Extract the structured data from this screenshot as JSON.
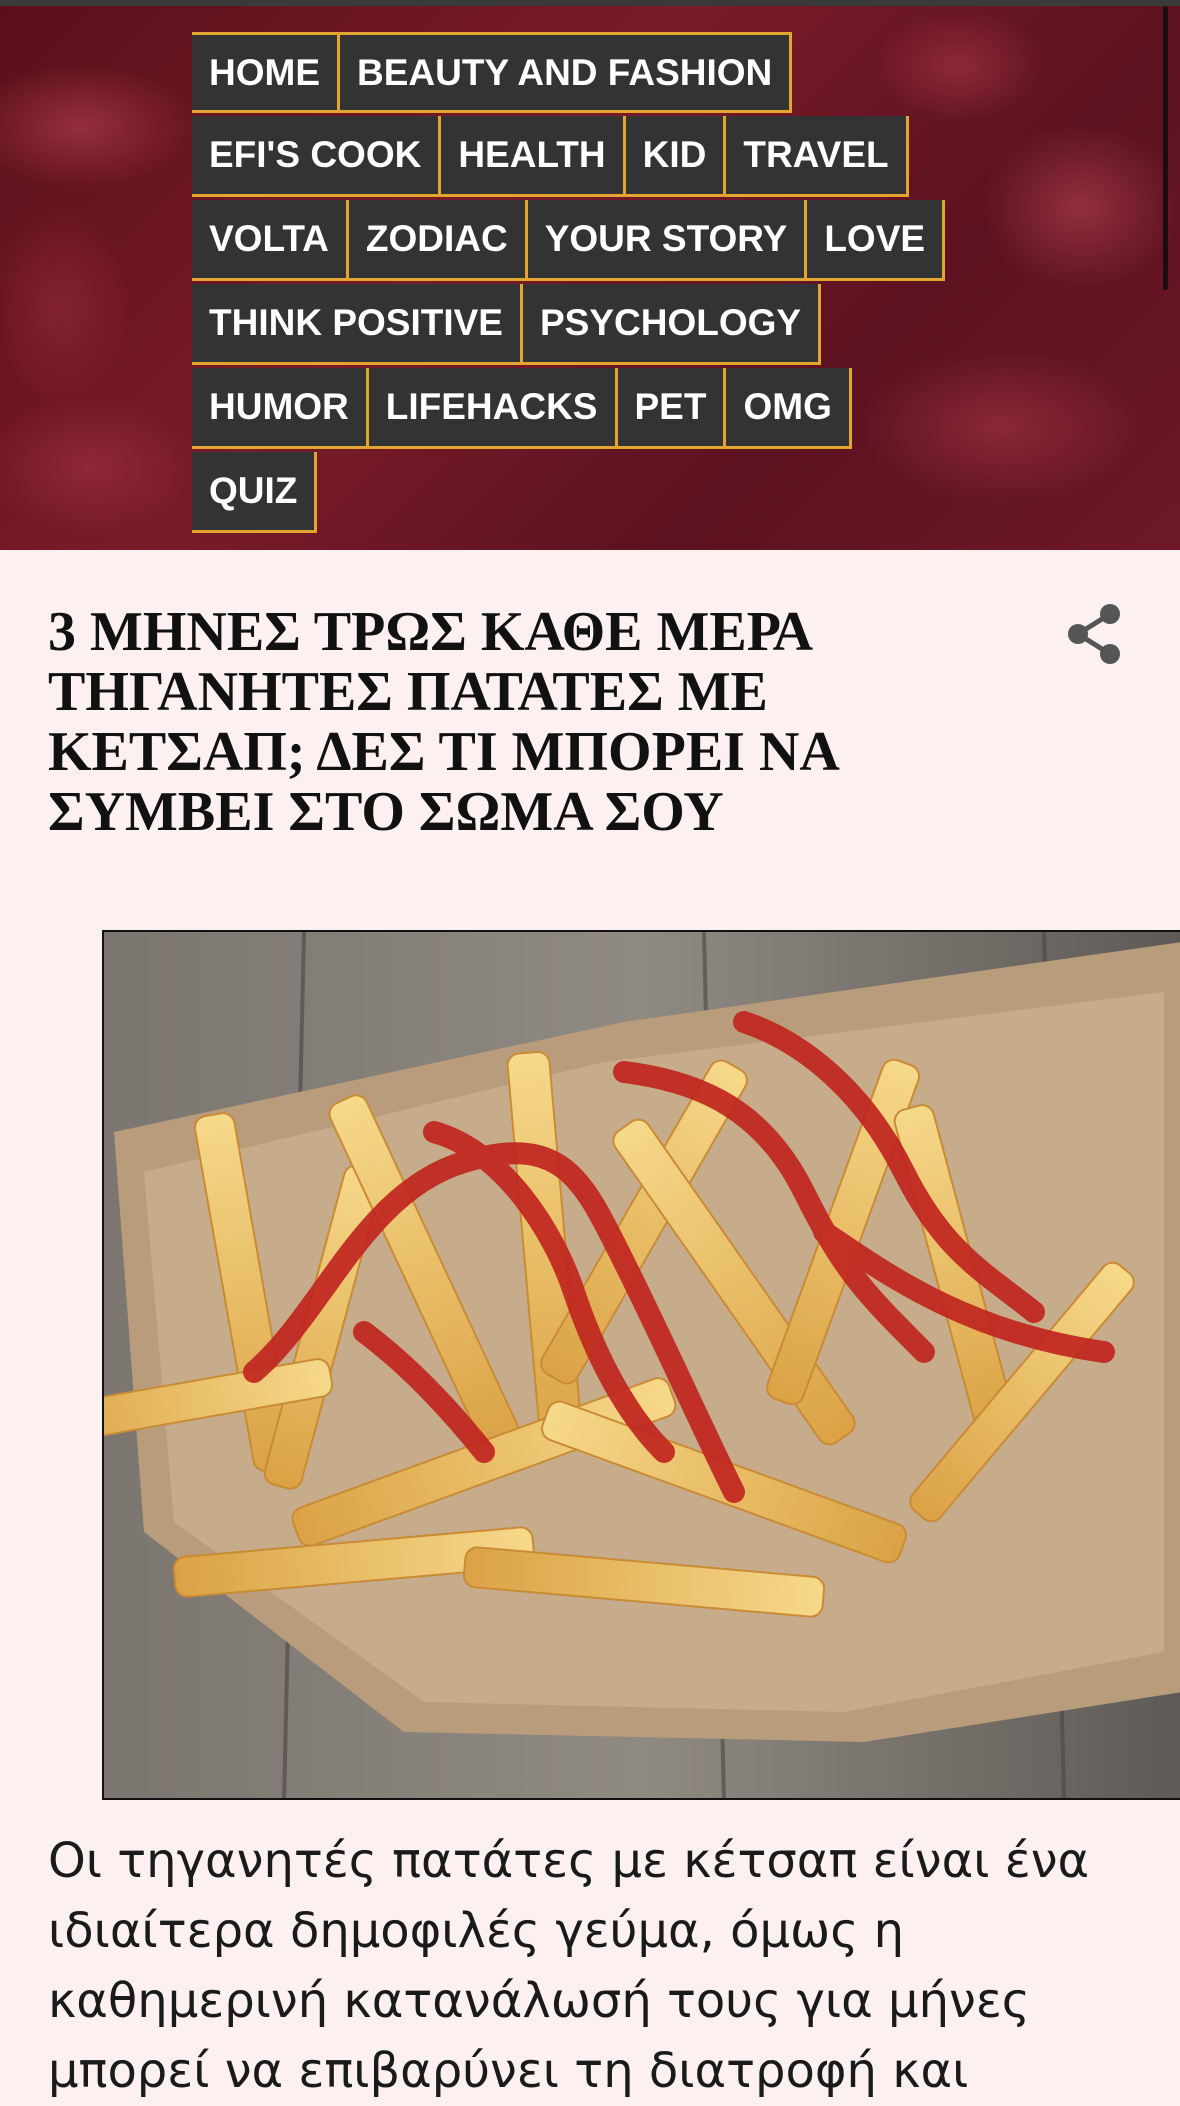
{
  "nav": {
    "rows": [
      [
        "HOME",
        "BEAUTY AND FASHION"
      ],
      [
        "EFI'S COOK",
        "HEALTH",
        "KID",
        "TRAVEL"
      ],
      [
        "VOLTA",
        "ZODIAC",
        "YOUR STORY",
        "LOVE"
      ],
      [
        "THINK POSITIVE",
        "PSYCHOLOGY"
      ],
      [
        "HUMOR",
        "LIFEHACKS",
        "PET",
        "OMG"
      ],
      [
        "QUIZ"
      ]
    ]
  },
  "article": {
    "title": "3 ΜΗΝΕΣ ΤΡΩΣ ΚΑΘΕ ΜΕΡΑ ΤΗΓΑΝΗΤΕΣ ΠΑΤΑΤΕΣ ΜΕ ΚΕΤΣΑΠ; ΔΕΣ ΤΙ ΜΠΟΡΕΙ ΝΑ ΣΥΜΒΕΙ ΣΤΟ ΣΩΜΑ ΣΟΥ",
    "body": "Οι τηγανητές πατάτες με κέτσαπ είναι ένα ιδιαίτερα δημοφιλές γεύμα, όμως η καθημερινή κατανάλωσή τους για μήνες μπορεί να επιβαρύνει τη διατροφή και"
  },
  "icons": {
    "share": "share-icon"
  },
  "colors": {
    "nav_bg": "#333333",
    "nav_border": "#e2a530",
    "header_bg": "#6e1826",
    "page_bg": "#fcf0f1"
  }
}
